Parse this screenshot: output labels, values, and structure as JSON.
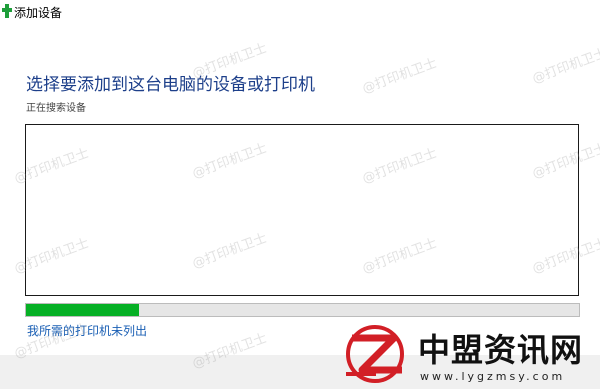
{
  "window": {
    "title": "添加设备"
  },
  "main": {
    "heading": "选择要添加到这台电脑的设备或打印机",
    "status": "正在搜索设备",
    "progress": 0.205,
    "not_listed_link": "我所需的打印机未列出"
  },
  "watermark": {
    "text": "@打印机卫士"
  },
  "brand": {
    "name": "中盟资讯网",
    "url": "www.lygzmsy.com"
  },
  "colors": {
    "progress_fill": "#06b025",
    "heading": "#1d3f8a",
    "link": "#1a5fb4",
    "logo_red": "#d21f26"
  }
}
